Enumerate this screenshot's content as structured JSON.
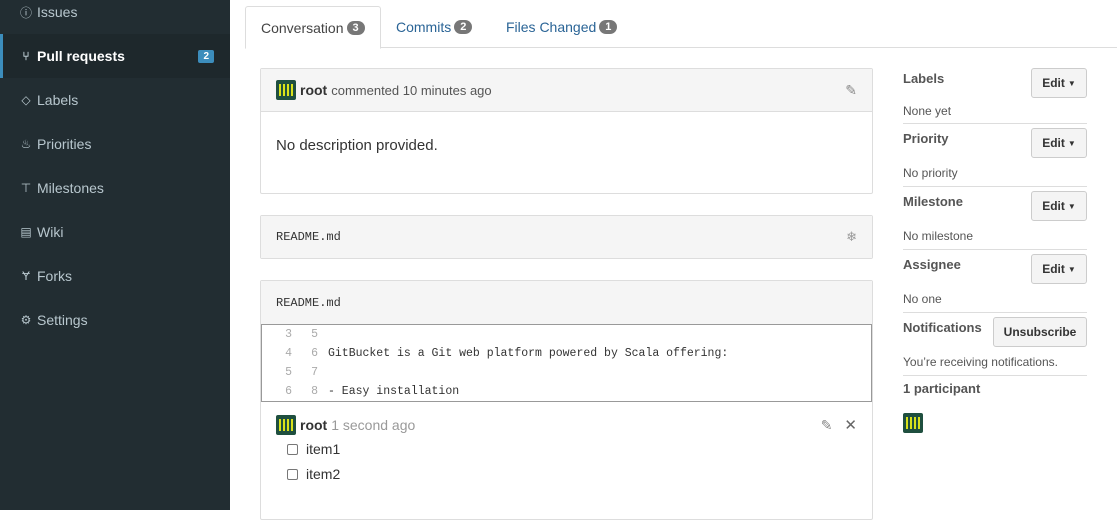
{
  "sidebar": {
    "items": [
      {
        "label": "Issues",
        "icon": "info"
      },
      {
        "label": "Pull requests",
        "icon": "pull-request",
        "badge": "2"
      },
      {
        "label": "Labels",
        "icon": "tag"
      },
      {
        "label": "Priorities",
        "icon": "flame"
      },
      {
        "label": "Milestones",
        "icon": "milestone"
      },
      {
        "label": "Wiki",
        "icon": "book"
      },
      {
        "label": "Forks",
        "icon": "fork"
      },
      {
        "label": "Settings",
        "icon": "gear"
      }
    ]
  },
  "tabs": [
    {
      "label": "Conversation",
      "count": "3"
    },
    {
      "label": "Commits",
      "count": "2"
    },
    {
      "label": "Files Changed",
      "count": "1"
    }
  ],
  "description_comment": {
    "author": "root",
    "action": "commented 10 minutes ago",
    "body": "No description provided."
  },
  "file_box": {
    "filename": "README.md"
  },
  "diff_comment": {
    "filename": "README.md",
    "lines": [
      {
        "old": "3",
        "new": "5",
        "text": ""
      },
      {
        "old": "4",
        "new": "6",
        "text": "GitBucket is a Git web platform powered by Scala offering:"
      },
      {
        "old": "5",
        "new": "7",
        "text": ""
      },
      {
        "old": "6",
        "new": "8",
        "text": "- Easy installation"
      }
    ],
    "author": "root",
    "time": "1 second ago",
    "tasks": [
      "item1",
      "item2"
    ]
  },
  "right_sidebar": {
    "labels": {
      "title": "Labels",
      "value": "None yet",
      "button": "Edit"
    },
    "priority": {
      "title": "Priority",
      "value": "No priority",
      "button": "Edit"
    },
    "milestone": {
      "title": "Milestone",
      "value": "No milestone",
      "button": "Edit"
    },
    "assignee": {
      "title": "Assignee",
      "value": "No one",
      "button": "Edit"
    },
    "notifications": {
      "title": "Notifications",
      "button": "Unsubscribe",
      "status": "You’re receiving notifications."
    },
    "participants": {
      "title": "1 participant"
    }
  }
}
